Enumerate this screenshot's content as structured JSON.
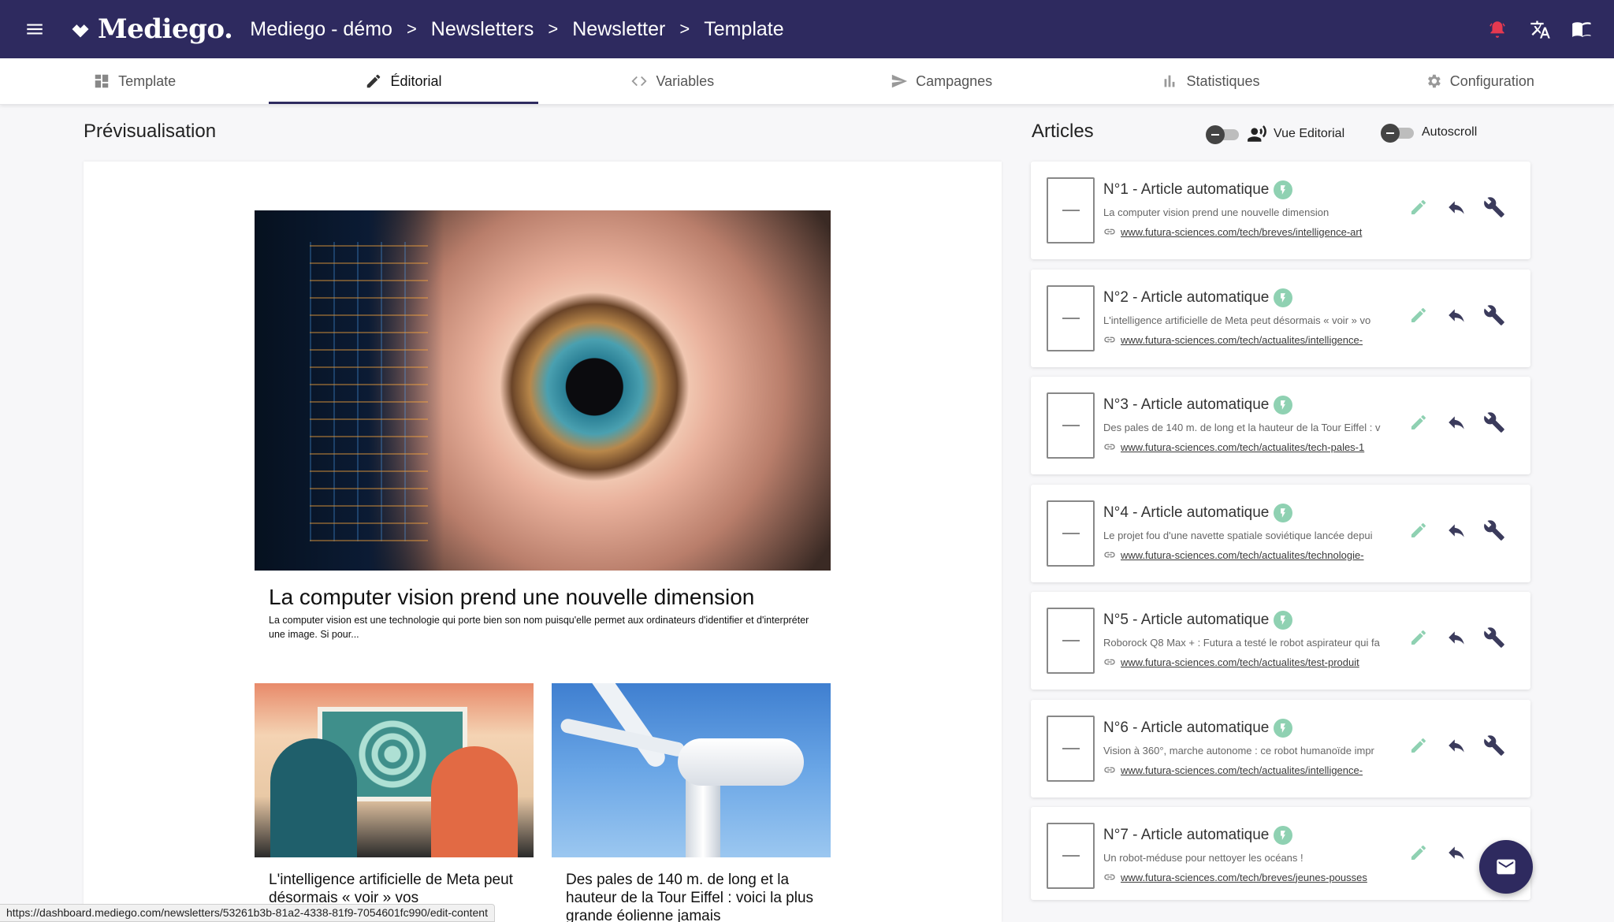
{
  "header": {
    "menu_icon": "hamburger-icon",
    "brand": "Mediego.",
    "breadcrumb": [
      "Mediego - démo",
      "Newsletters",
      "Newsletter",
      "Template"
    ],
    "separator": ">",
    "actions": [
      "alarm-icon",
      "translate-icon",
      "book-icon"
    ]
  },
  "tabs": [
    {
      "label": "Template",
      "icon": "dashboard-icon"
    },
    {
      "label": "Éditorial",
      "icon": "pencil-icon",
      "active": true
    },
    {
      "label": "Variables",
      "icon": "code-icon"
    },
    {
      "label": "Campagnes",
      "icon": "send-icon"
    },
    {
      "label": "Statistiques",
      "icon": "bar-chart-icon"
    },
    {
      "label": "Configuration",
      "icon": "gear-icon"
    }
  ],
  "preview": {
    "title": "Prévisualisation",
    "hero_title": "La computer vision prend une nouvelle dimension",
    "hero_desc": "La computer vision est une technologie qui porte bien son nom puisqu'elle permet aux ordinateurs d'identifier et d'interpréter une image. Si pour...",
    "secondary": [
      {
        "title": "L'intelligence artificielle de Meta peut désormais « voir » vos"
      },
      {
        "title": "Des pales de 140 m. de long et la hauteur de la Tour Eiffel : voici la plus grande éolienne jamais"
      }
    ]
  },
  "articles": {
    "title": "Articles",
    "toggles": [
      {
        "label": "Vue Editorial",
        "state": "off"
      },
      {
        "label": "Autoscroll",
        "state": "off"
      }
    ],
    "items": [
      {
        "title": "N°1 - Article automatique",
        "desc": "La computer vision prend une nouvelle dimension",
        "url": "www.futura-sciences.com/tech/breves/intelligence-art"
      },
      {
        "title": "N°2 - Article automatique",
        "desc": "L'intelligence artificielle de Meta peut désormais « voir » vo",
        "url": "www.futura-sciences.com/tech/actualites/intelligence-"
      },
      {
        "title": "N°3 - Article automatique",
        "desc": "Des pales de 140 m. de long et la hauteur de la Tour Eiffel : v",
        "url": "www.futura-sciences.com/tech/actualites/tech-pales-1"
      },
      {
        "title": "N°4 - Article automatique",
        "desc": "Le projet fou d'une navette spatiale soviétique lancée depui",
        "url": "www.futura-sciences.com/tech/actualites/technologie-"
      },
      {
        "title": "N°5 - Article automatique",
        "desc": "Roborock Q8 Max + : Futura a testé le robot aspirateur qui fa",
        "url": "www.futura-sciences.com/tech/actualites/test-produit"
      },
      {
        "title": "N°6 - Article automatique",
        "desc": "Vision à 360°, marche autonome : ce robot humanoïde impr",
        "url": "www.futura-sciences.com/tech/actualites/intelligence-"
      },
      {
        "title": "N°7 - Article automatique",
        "desc": "Un robot-méduse pour nettoyer les océans !",
        "url": "www.futura-sciences.com/tech/breves/jeunes-pousses"
      }
    ]
  },
  "status_url": "https://dashboard.mediego.com/newsletters/53261b3b-81a2-4338-81f9-7054601fc990/edit-content",
  "colors": {
    "brand": "#2e2a5f",
    "accent_green": "#8fd1b2",
    "alert_red": "#e53950"
  }
}
